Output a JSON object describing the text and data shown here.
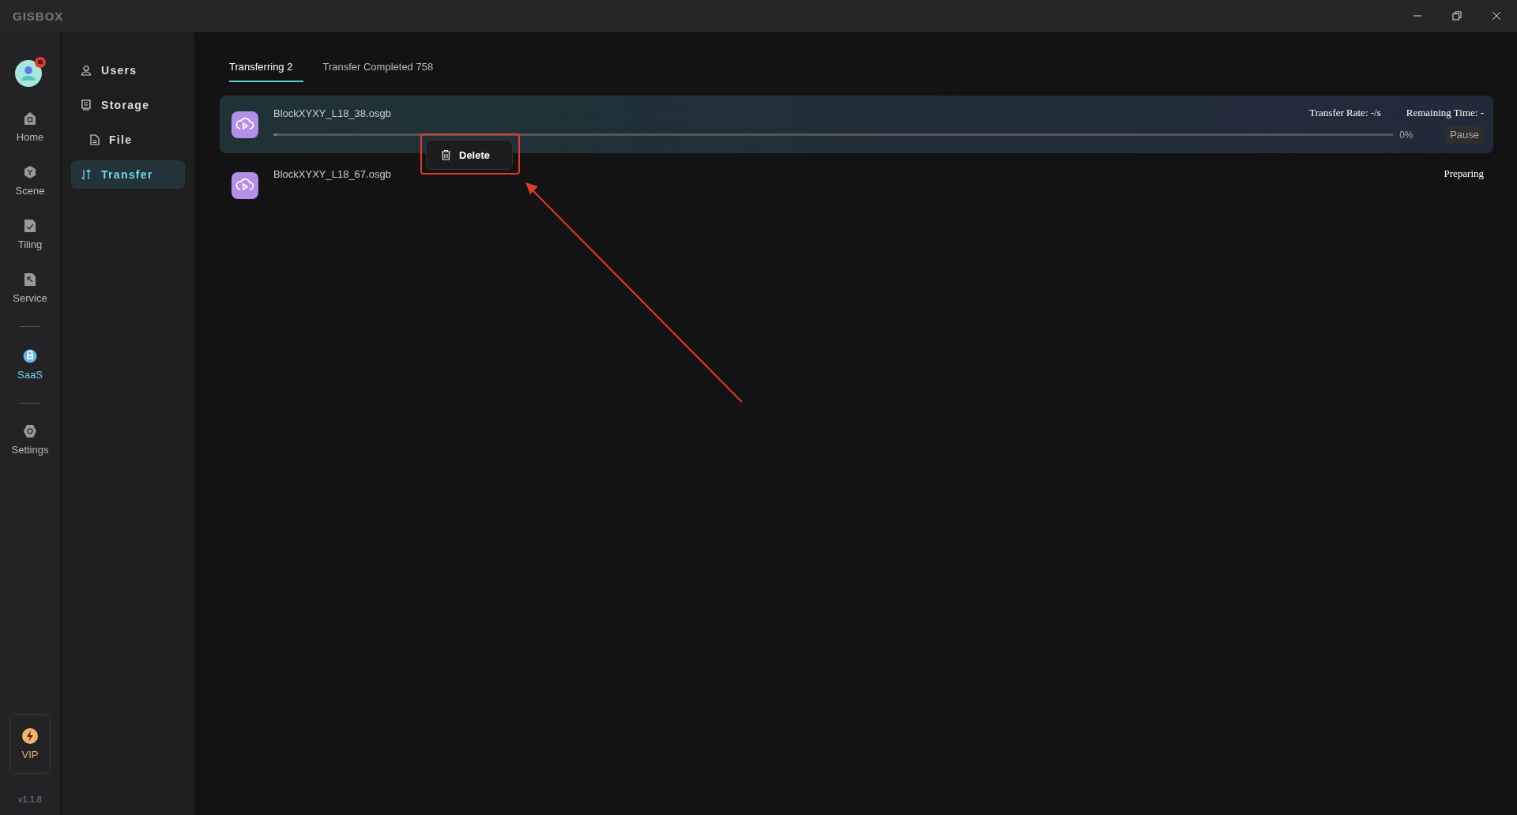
{
  "window": {
    "title": "GISBOX"
  },
  "rail": {
    "items": [
      {
        "label": "Home",
        "kind": "home",
        "selected": false
      },
      {
        "label": "Scene",
        "kind": "scene",
        "selected": false
      },
      {
        "label": "Tiling",
        "kind": "tiling",
        "selected": false
      },
      {
        "label": "Service",
        "kind": "service",
        "selected": false
      },
      {
        "label": "SaaS",
        "kind": "saas",
        "selected": true
      },
      {
        "label": "Settings",
        "kind": "settings",
        "selected": false
      }
    ],
    "vip": "VIP",
    "version": "v1.1.8"
  },
  "sidebar": {
    "items": [
      {
        "label": "Users",
        "kind": "users",
        "selected": false
      },
      {
        "label": "Storage",
        "kind": "storage",
        "selected": false,
        "children": [
          {
            "label": "File",
            "kind": "file",
            "selected": false
          }
        ]
      },
      {
        "label": "Transfer",
        "kind": "transfer",
        "selected": true
      }
    ]
  },
  "tabs": [
    {
      "label": "Transferring 2",
      "selected": true
    },
    {
      "label": "Transfer Completed 758",
      "selected": false
    }
  ],
  "transfers": [
    {
      "name": "BlockXYXY_L18_38.osgb",
      "kind": "active",
      "rate": "Transfer Rate: -/s",
      "remaining": "Remaining Time: -",
      "level": 0,
      "percent": "0%",
      "action": "Pause"
    },
    {
      "name": "BlockXYXY_L18_67.osgb",
      "kind": "waiting",
      "status": "Preparing"
    }
  ],
  "context_menu": {
    "label": "Delete"
  }
}
